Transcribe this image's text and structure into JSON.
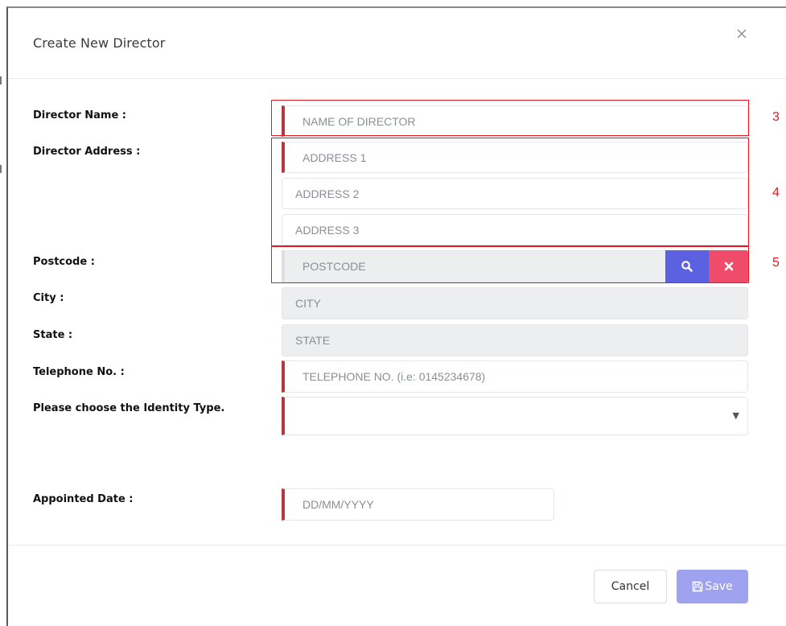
{
  "modal": {
    "title": "Create New Director"
  },
  "form": {
    "director_name": {
      "label": "Director Name :",
      "placeholder": "NAME OF DIRECTOR"
    },
    "director_address": {
      "label": "Director Address :",
      "address1_placeholder": "ADDRESS 1",
      "address2_placeholder": "ADDRESS 2",
      "address3_placeholder": "ADDRESS 3"
    },
    "postcode": {
      "label": "Postcode :",
      "placeholder": "POSTCODE"
    },
    "city": {
      "label": "City :",
      "placeholder": "CITY"
    },
    "state": {
      "label": "State :",
      "placeholder": "STATE"
    },
    "telephone": {
      "label": "Telephone No. :",
      "placeholder": "TELEPHONE NO. (i.e: 0145234678)"
    },
    "identity_type": {
      "label": "Please choose the Identity Type.",
      "selected": ""
    },
    "appointed_date": {
      "label": "Appointed Date :",
      "placeholder": "DD/MM/YYYY"
    }
  },
  "annotations": {
    "n3": "3",
    "n4": "4",
    "n5": "5"
  },
  "footer": {
    "cancel_label": "Cancel",
    "save_label": "Save"
  },
  "icons": {
    "close": "close-icon",
    "search": "search-icon",
    "clear": "times-icon",
    "save": "floppy-disk-icon"
  },
  "colors": {
    "required_bar": "#b03a40",
    "search_button": "#5b61e0",
    "clear_button": "#ef4b6b",
    "save_button": "#9fa3ef",
    "annotation": "#e8181e"
  }
}
